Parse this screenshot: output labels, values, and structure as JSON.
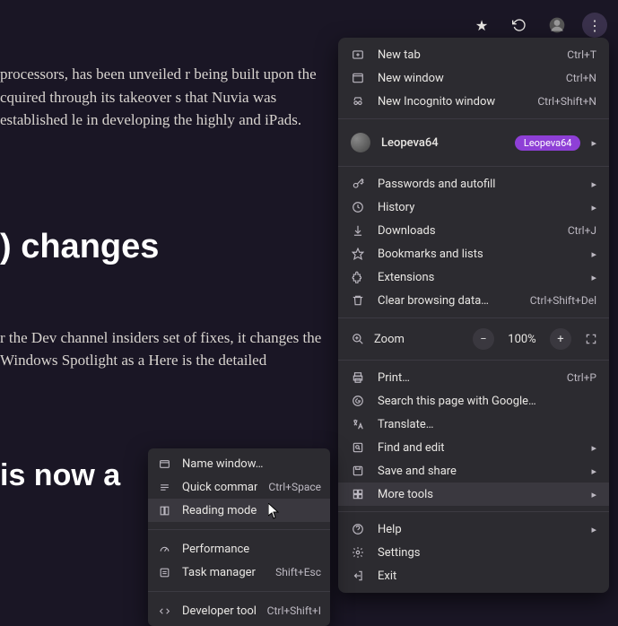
{
  "article": {
    "p1": "processors, has been unveiled r being built upon the cquired through its takeover s that Nuvia was established le in developing the highly and iPads.",
    "h1": ") changes",
    "p2": "r the Dev channel insiders set of fixes, it changes the Windows Spotlight as a Here is the detailed",
    "h2": "is now a"
  },
  "topbar": {
    "star": "★",
    "refresh": "↻",
    "avatar": "",
    "kebab": "⋮"
  },
  "profile": {
    "name": "Leopeva64",
    "badge": "Leopeva64"
  },
  "zoom": {
    "label": "Zoom",
    "value": "100%"
  },
  "menu": {
    "new_tab": {
      "label": "New tab",
      "accel": "Ctrl+T"
    },
    "new_window": {
      "label": "New window",
      "accel": "Ctrl+N"
    },
    "incognito": {
      "label": "New Incognito window",
      "accel": "Ctrl+Shift+N"
    },
    "passwords": {
      "label": "Passwords and autofill"
    },
    "history": {
      "label": "History"
    },
    "downloads": {
      "label": "Downloads",
      "accel": "Ctrl+J"
    },
    "bookmarks": {
      "label": "Bookmarks and lists"
    },
    "extensions": {
      "label": "Extensions"
    },
    "clear_data": {
      "label": "Clear browsing data…",
      "accel": "Ctrl+Shift+Del"
    },
    "print": {
      "label": "Print…",
      "accel": "Ctrl+P"
    },
    "search_google": {
      "label": "Search this page with Google…"
    },
    "translate": {
      "label": "Translate…"
    },
    "find": {
      "label": "Find and edit"
    },
    "save_share": {
      "label": "Save and share"
    },
    "more_tools": {
      "label": "More tools"
    },
    "help": {
      "label": "Help"
    },
    "settings": {
      "label": "Settings"
    },
    "exit": {
      "label": "Exit"
    }
  },
  "submenu": {
    "name_window": {
      "label": "Name window…"
    },
    "quick_commands": {
      "label": "Quick commands",
      "accel": "Ctrl+Space"
    },
    "reading_mode": {
      "label": "Reading mode"
    },
    "performance": {
      "label": "Performance"
    },
    "task_manager": {
      "label": "Task manager",
      "accel": "Shift+Esc"
    },
    "developer_tools": {
      "label": "Developer tools",
      "accel": "Ctrl+Shift+I"
    }
  }
}
